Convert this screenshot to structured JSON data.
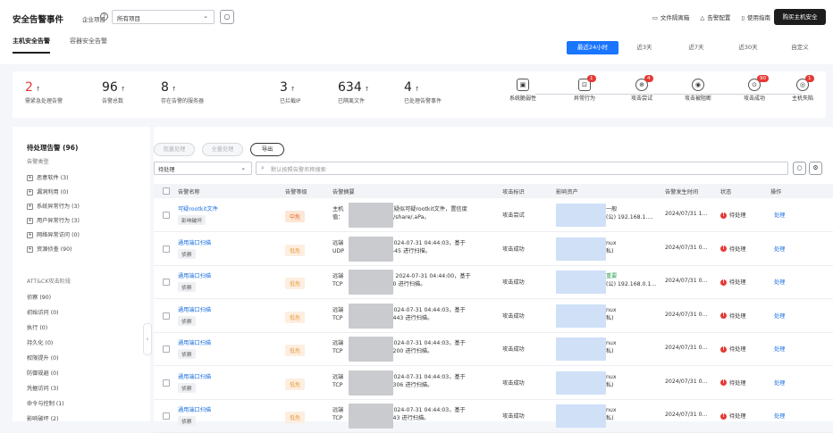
{
  "header": {
    "title": "安全告警事件",
    "scope_label": "企业项目",
    "help": "?",
    "project_value": "所有项目",
    "links": [
      "文件隔离箱",
      "告警配置",
      "使用指南"
    ],
    "buy_button": "购买主机安全"
  },
  "tabs": [
    "主机安全告警",
    "容器安全告警"
  ],
  "time_filters": [
    "最近24小时",
    "近3天",
    "近7天",
    "近30天",
    "自定义"
  ],
  "stats": [
    {
      "num": "2",
      "label": "需紧急处理告警",
      "color": "#e53935"
    },
    {
      "num": "96",
      "label": "告警总数"
    },
    {
      "num": "8",
      "label": "存在告警的服务器"
    },
    {
      "num": "3",
      "label": "已拦截IP"
    },
    {
      "num": "634",
      "label": "已隔离文件"
    },
    {
      "num": "4",
      "label": "已处理告警事件"
    }
  ],
  "stages": [
    {
      "label": "系统脆弱性",
      "badge": ""
    },
    {
      "label": "异常行为",
      "badge": "1"
    },
    {
      "label": "攻击尝试",
      "badge": "4"
    },
    {
      "label": "攻击被阻断",
      "badge": ""
    },
    {
      "label": "攻击成功",
      "badge": "90"
    },
    {
      "label": "主机失陷",
      "badge": "1"
    }
  ],
  "left_panel": {
    "title": "待处理告警 (96)",
    "type_header": "告警类型",
    "types": [
      "恶意软件 (3)",
      "漏洞利用 (0)",
      "系统异常行为 (3)",
      "用户异常行为 (3)",
      "网络异常访问 (0)",
      "资源侦查 (90)"
    ],
    "attck_header": "ATT&CK攻击阶段",
    "stages": [
      "侦察 (90)",
      "初始访问 (0)",
      "执行 (0)",
      "持久化 (0)",
      "权限提升 (0)",
      "防御规避 (0)",
      "凭据访问 (3)",
      "命令与控制 (1)",
      "影响破坏 (2)"
    ]
  },
  "toolbar": {
    "batch": "批量处理",
    "all": "全量处理",
    "export": "导出",
    "status_value": "待处理",
    "search_placeholder": "默认按照告警名称搜索"
  },
  "table": {
    "headers": [
      "告警名称",
      "告警等级",
      "告警摘要",
      "攻击标识",
      "影响资产",
      "告警发生时间",
      "状态",
      "操作"
    ],
    "rows": [
      {
        "name": "可疑rootkit文件",
        "tag": "影响破坏",
        "level": "中危",
        "level_type": "mid",
        "sum1": "主机",
        "sum1b": "存在疑似可疑rootkit文件，置信度",
        "sum2": "值：",
        "sum2b": "/usr/share/.aPa。",
        "attack": "攻击尝试",
        "asset1": "一般",
        "asset2": "(公) 192.168.1....",
        "time": "2024/07/31 1...",
        "status": "待处理",
        "op": "处理"
      },
      {
        "name": "通用端口扫描",
        "tag": "侦察",
        "level": "低危",
        "level_type": "low",
        "sum1": "远端",
        "sum1b": "在 2024-07-31 04:44:03，基于",
        "sum2": "UDP",
        "sum2b": "口 445 进行扫描。",
        "attack": "攻击成功",
        "asset1": "nux",
        "asset2": "私)",
        "time": "2024/07/31 0...",
        "status": "待处理",
        "op": "处理"
      },
      {
        "name": "通用端口扫描",
        "tag": "侦察",
        "level": "低危",
        "level_type": "low",
        "sum1": "远端",
        "sum1b": "2 在 2024-07-31 04:44:00，基于",
        "sum2": "TCP",
        "sum2b": "口 80 进行扫描。",
        "attack": "攻击成功",
        "asset1": "重要",
        "asset2": "(公) 192.168.0.1...",
        "time": "2024/07/31 0...",
        "status": "待处理",
        "op": "处理"
      },
      {
        "name": "通用端口扫描",
        "tag": "侦察",
        "level": "低危",
        "level_type": "low",
        "sum1": "远端",
        "sum1b": "在 2024-07-31 04:44:03，基于",
        "sum2": "TCP",
        "sum2b": "口 9443 进行扫描。",
        "attack": "攻击成功",
        "asset1": "nux",
        "asset2": "私)",
        "time": "2024/07/31 0...",
        "status": "待处理",
        "op": "处理"
      },
      {
        "name": "通用端口扫描",
        "tag": "侦察",
        "level": "低危",
        "level_type": "low",
        "sum1": "远端",
        "sum1b": "在 2024-07-31 04:44:03，基于",
        "sum2": "TCP",
        "sum2b": "口 9200 进行扫描。",
        "attack": "攻击成功",
        "asset1": "nux",
        "asset2": "私)",
        "time": "2024/07/31 0...",
        "status": "待处理",
        "op": "处理"
      },
      {
        "name": "通用端口扫描",
        "tag": "侦察",
        "level": "低危",
        "level_type": "low",
        "sum1": "远端",
        "sum1b": "在 2024-07-31 04:44:03，基于",
        "sum2": "TCP",
        "sum2b": "口 3306 进行扫描。",
        "attack": "攻击成功",
        "asset1": "nux",
        "asset2": "私)",
        "time": "2024/07/31 0...",
        "status": "待处理",
        "op": "处理"
      },
      {
        "name": "通用端口扫描",
        "tag": "侦察",
        "level": "低危",
        "level_type": "low",
        "sum1": "远端",
        "sum1b": "在 2024-07-31 04:44:03，基于",
        "sum2": "TCP",
        "sum2b": "口 443 进行扫描。",
        "attack": "攻击成功",
        "asset1": "nux",
        "asset2": "私)",
        "time": "2024/07/31 0...",
        "status": "待处理",
        "op": "处理"
      }
    ]
  }
}
